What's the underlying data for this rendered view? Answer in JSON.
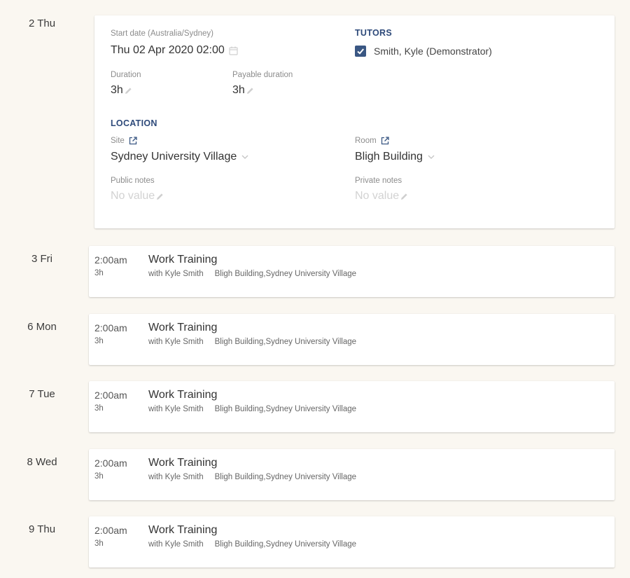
{
  "expanded_day": {
    "day_label": "2 Thu",
    "start_date_label": "Start date (Australia/Sydney)",
    "start_date_value": "Thu 02 Apr 2020 02:00",
    "duration_label": "Duration",
    "duration_value": "3h",
    "payable_duration_label": "Payable duration",
    "payable_duration_value": "3h",
    "tutors_heading": "TUTORS",
    "tutor_name": "Smith, Kyle (Demonstrator)",
    "tutor_checked": true,
    "location_heading": "LOCATION",
    "site_label": "Site",
    "site_value": "Sydney University Village",
    "room_label": "Room",
    "room_value": "Bligh Building",
    "public_notes_label": "Public notes",
    "public_notes_value": "No value",
    "private_notes_label": "Private notes",
    "private_notes_value": "No value"
  },
  "sessions": [
    {
      "day_label": "3 Fri",
      "time": "2:00am",
      "duration": "3h",
      "title": "Work Training",
      "tutor": "with Kyle Smith",
      "location": "Bligh Building,Sydney University Village"
    },
    {
      "day_label": "6 Mon",
      "time": "2:00am",
      "duration": "3h",
      "title": "Work Training",
      "tutor": "with Kyle Smith",
      "location": "Bligh Building,Sydney University Village"
    },
    {
      "day_label": "7 Tue",
      "time": "2:00am",
      "duration": "3h",
      "title": "Work Training",
      "tutor": "with Kyle Smith",
      "location": "Bligh Building,Sydney University Village"
    },
    {
      "day_label": "8 Wed",
      "time": "2:00am",
      "duration": "3h",
      "title": "Work Training",
      "tutor": "with Kyle Smith",
      "location": "Bligh Building,Sydney University Village"
    },
    {
      "day_label": "9 Thu",
      "time": "2:00am",
      "duration": "3h",
      "title": "Work Training",
      "tutor": "with Kyle Smith",
      "location": "Bligh Building,Sydney University Village"
    }
  ],
  "colors": {
    "background": "#faf7f1",
    "accent": "#2e4a7a",
    "checkbox": "#3a5783"
  }
}
